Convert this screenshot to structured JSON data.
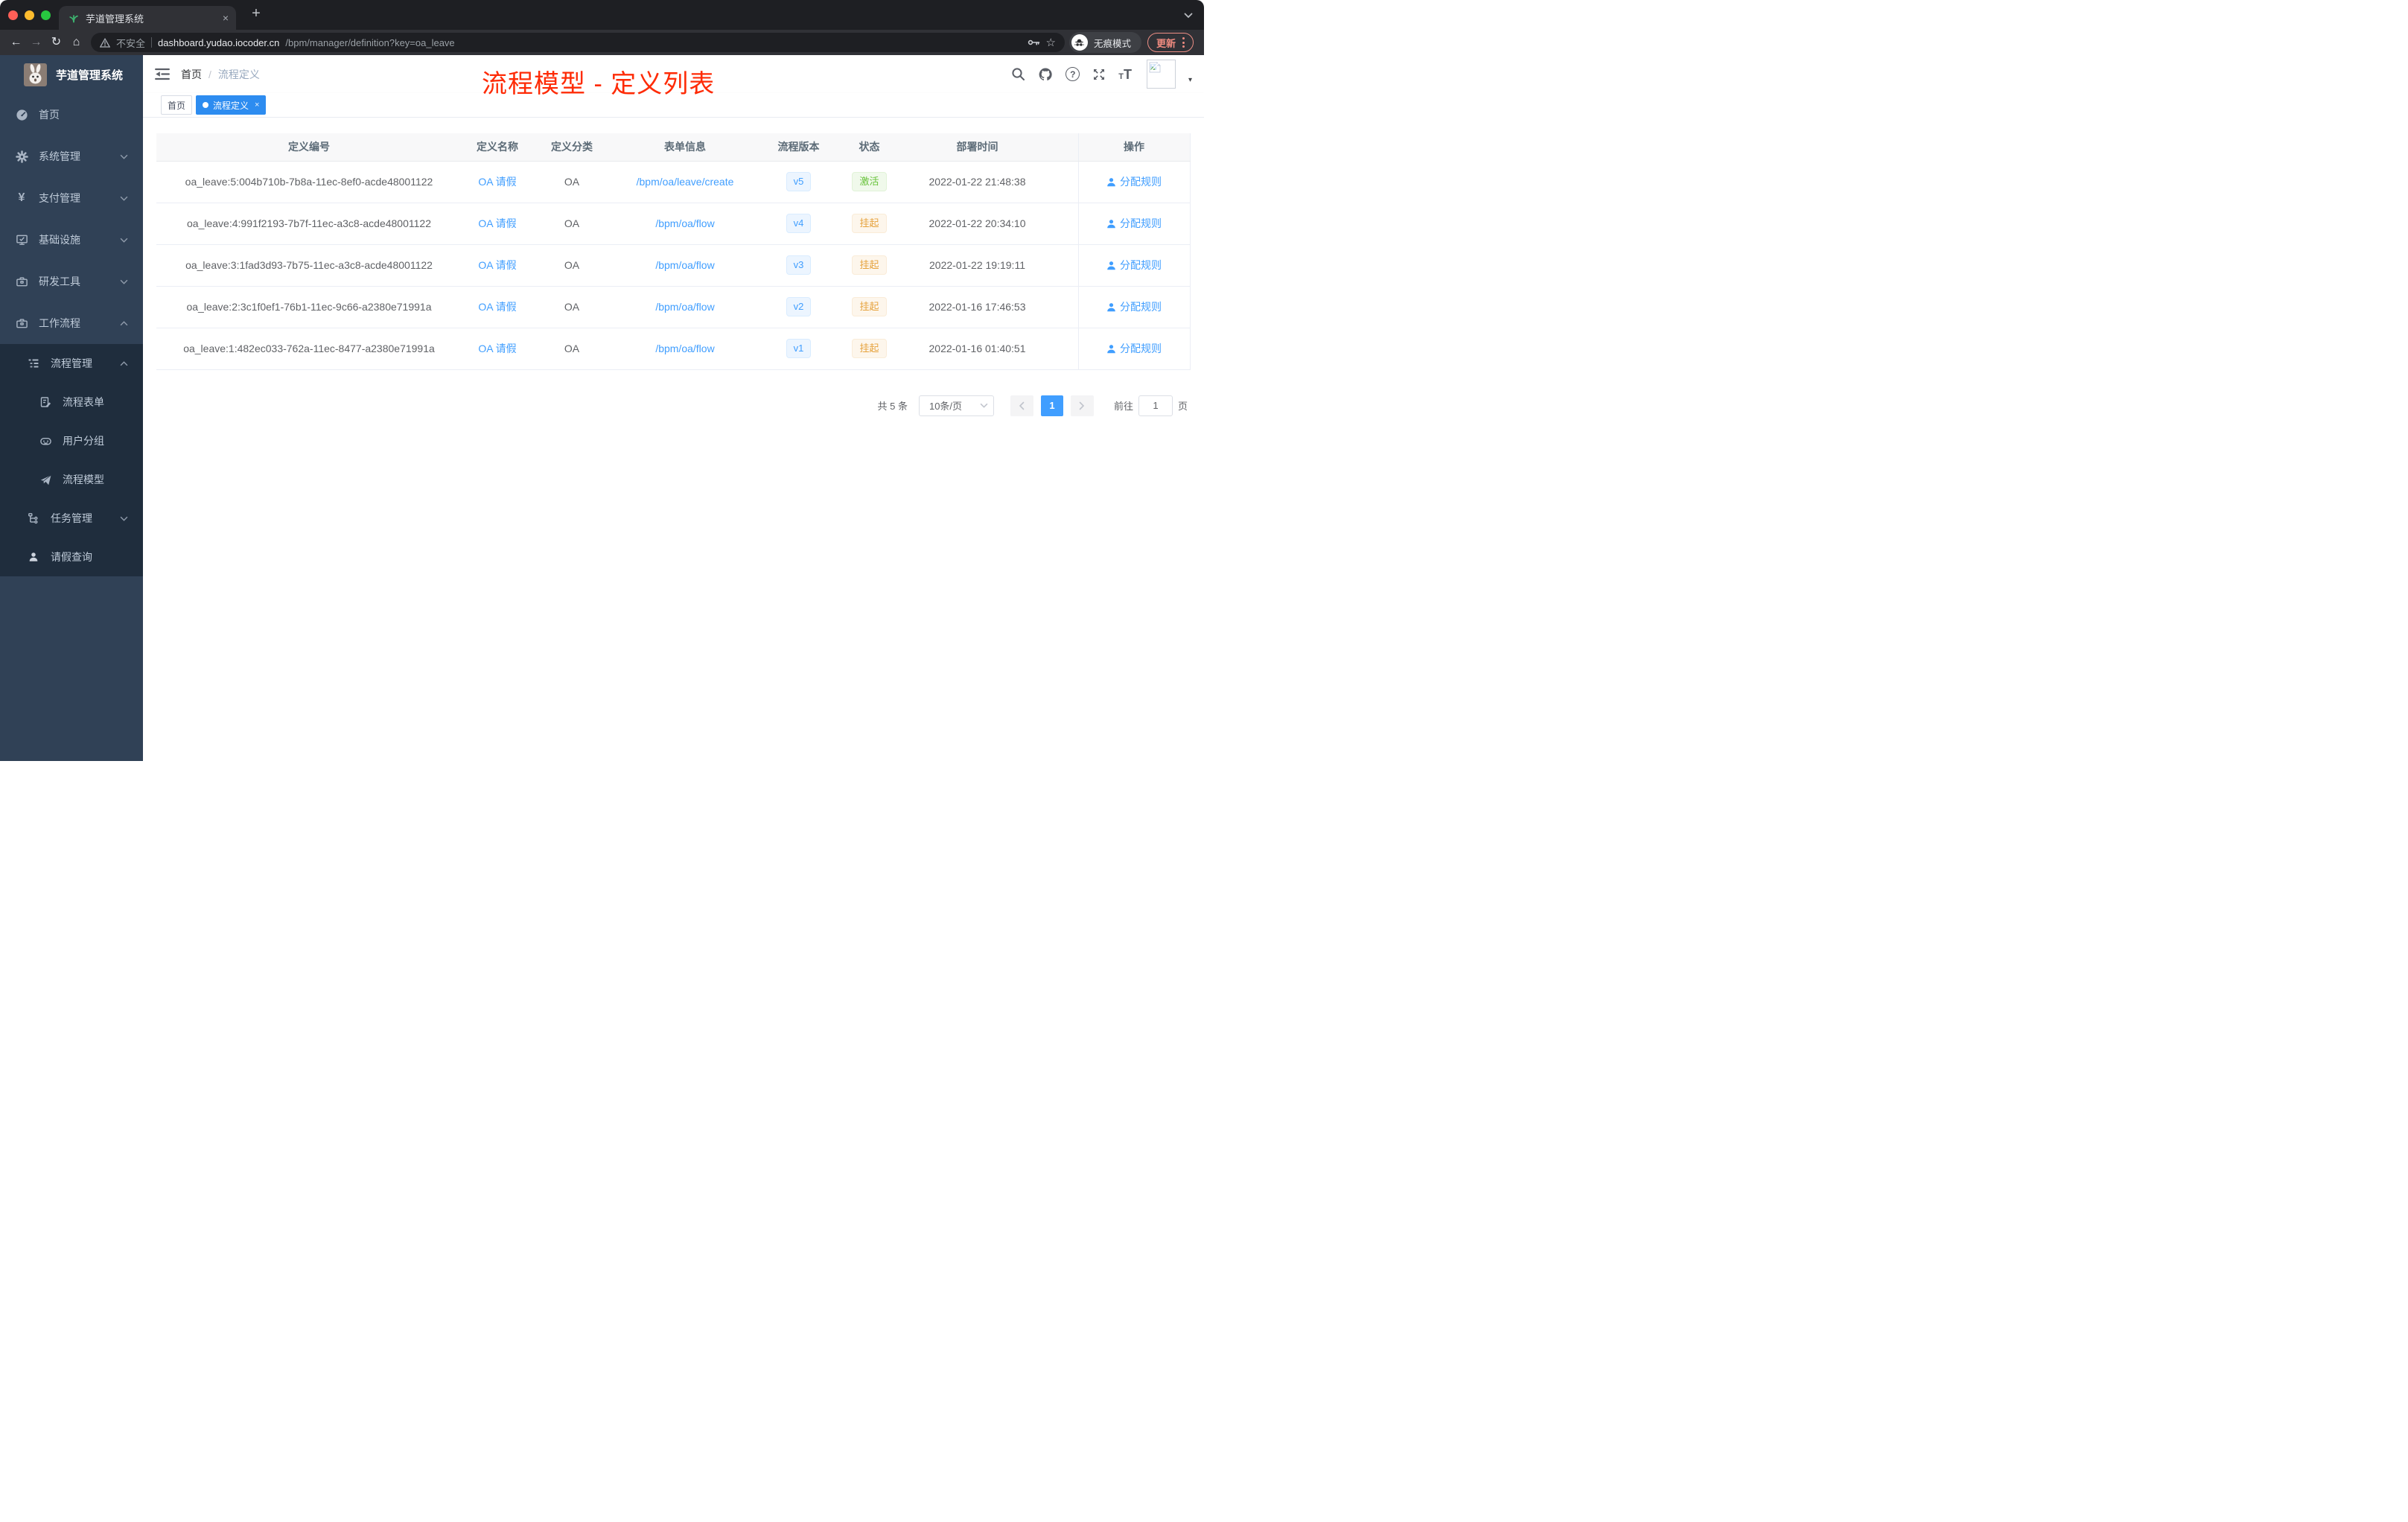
{
  "browser": {
    "tab_title": "芋道管理系统",
    "security_label": "不安全",
    "url_host": "dashboard.yudao.iocoder.cn",
    "url_path": "/bpm/manager/definition?key=oa_leave",
    "incognito_label": "无痕模式",
    "update_label": "更新"
  },
  "icons": {
    "back": "←",
    "forward": "→",
    "reload": "↻",
    "home": "⌂",
    "star": "☆",
    "plus": "+",
    "close": "×",
    "question": "?",
    "caret_down": "▾",
    "yen": "¥",
    "font_small": "T",
    "font_large": "T"
  },
  "sidebar": {
    "logo_title": "芋道管理系统",
    "items": [
      {
        "label": "首页"
      },
      {
        "label": "系统管理"
      },
      {
        "label": "支付管理"
      },
      {
        "label": "基础设施"
      },
      {
        "label": "研发工具"
      },
      {
        "label": "工作流程"
      }
    ],
    "submenu": {
      "manage": "流程管理",
      "children": [
        "流程表单",
        "用户分组",
        "流程模型"
      ],
      "tasks": "任务管理",
      "leave": "请假查询"
    }
  },
  "header": {
    "breadcrumb": [
      "首页",
      "流程定义"
    ],
    "separator": "/",
    "annotation": "流程模型 - 定义列表"
  },
  "tags": {
    "home": "首页",
    "active": "流程定义"
  },
  "table": {
    "columns": [
      "定义编号",
      "定义名称",
      "定义分类",
      "表单信息",
      "流程版本",
      "状态",
      "部署时间",
      "操作"
    ],
    "action_label": "分配规则",
    "rows": [
      {
        "id": "oa_leave:5:004b710b-7b8a-11ec-8ef0-acde48001122",
        "name": "OA 请假",
        "category": "OA",
        "form": "/bpm/oa/leave/create",
        "version": "v5",
        "status": "激活",
        "status_type": "success",
        "deploy_time": "2022-01-22 21:48:38"
      },
      {
        "id": "oa_leave:4:991f2193-7b7f-11ec-a3c8-acde48001122",
        "name": "OA 请假",
        "category": "OA",
        "form": "/bpm/oa/flow",
        "version": "v4",
        "status": "挂起",
        "status_type": "warning",
        "deploy_time": "2022-01-22 20:34:10"
      },
      {
        "id": "oa_leave:3:1fad3d93-7b75-11ec-a3c8-acde48001122",
        "name": "OA 请假",
        "category": "OA",
        "form": "/bpm/oa/flow",
        "version": "v3",
        "status": "挂起",
        "status_type": "warning",
        "deploy_time": "2022-01-22 19:19:11"
      },
      {
        "id": "oa_leave:2:3c1f0ef1-76b1-11ec-9c66-a2380e71991a",
        "name": "OA 请假",
        "category": "OA",
        "form": "/bpm/oa/flow",
        "version": "v2",
        "status": "挂起",
        "status_type": "warning",
        "deploy_time": "2022-01-16 17:46:53"
      },
      {
        "id": "oa_leave:1:482ec033-762a-11ec-8477-a2380e71991a",
        "name": "OA 请假",
        "category": "OA",
        "form": "/bpm/oa/flow",
        "version": "v1",
        "status": "挂起",
        "status_type": "warning",
        "deploy_time": "2022-01-16 01:40:51"
      }
    ]
  },
  "pagination": {
    "total": "共 5 条",
    "page_size": "10条/页",
    "page": "1",
    "goto_label": "前往",
    "goto_value": "1",
    "page_unit": "页"
  },
  "colors": {
    "accent": "#409eff",
    "success": "#67c23a",
    "warning": "#e6a23c",
    "annotation_red": "#fe2b06",
    "sidebar_bg": "#304156",
    "submenu_bg": "#1f2d3d",
    "tag_active": "#2d8cf0",
    "chrome_dark": "#1e1f23"
  }
}
